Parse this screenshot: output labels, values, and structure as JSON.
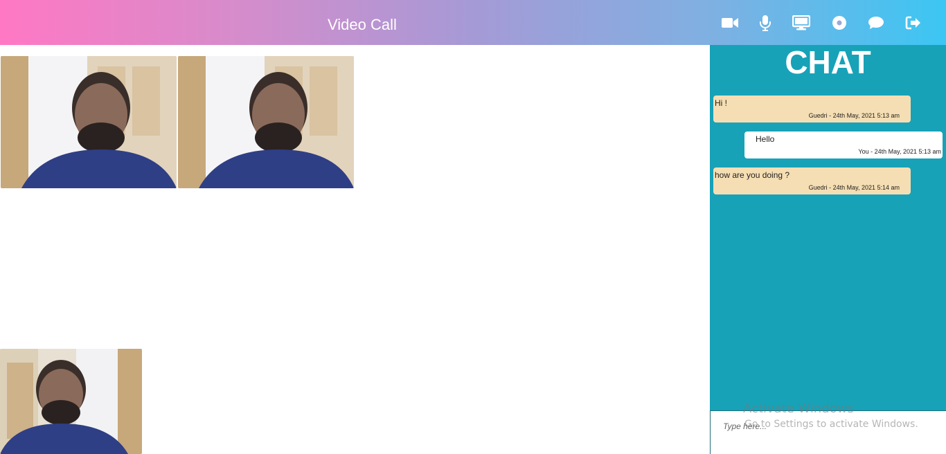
{
  "header": {
    "title": "Video Call",
    "controls": [
      {
        "name": "video-camera-icon"
      },
      {
        "name": "microphone-icon"
      },
      {
        "name": "screen-share-icon"
      },
      {
        "name": "record-icon"
      },
      {
        "name": "chat-bubble-icon"
      },
      {
        "name": "leave-call-icon"
      }
    ]
  },
  "chat": {
    "heading": "CHAT",
    "messages": [
      {
        "text": "Hi !",
        "meta": "Guedri - 24th May, 2021 5:13 am",
        "from": "other"
      },
      {
        "text": "Hello",
        "meta": "You - 24th May, 2021 5:13 am",
        "from": "self"
      },
      {
        "text": "how are you doing ?",
        "meta": "Guedri - 24th May, 2021 5:14 am",
        "from": "other"
      }
    ],
    "input_placeholder": "Type here..."
  },
  "watermark": {
    "title": "Activate Windows",
    "subtitle": "Go to Settings to activate Windows."
  },
  "colors": {
    "header_gradient_start": "#ff78c4",
    "header_gradient_end": "#3cc6f3",
    "chat_background": "#17a2b8",
    "incoming_bubble": "#f5deb3",
    "outgoing_bubble": "#ffffff"
  }
}
